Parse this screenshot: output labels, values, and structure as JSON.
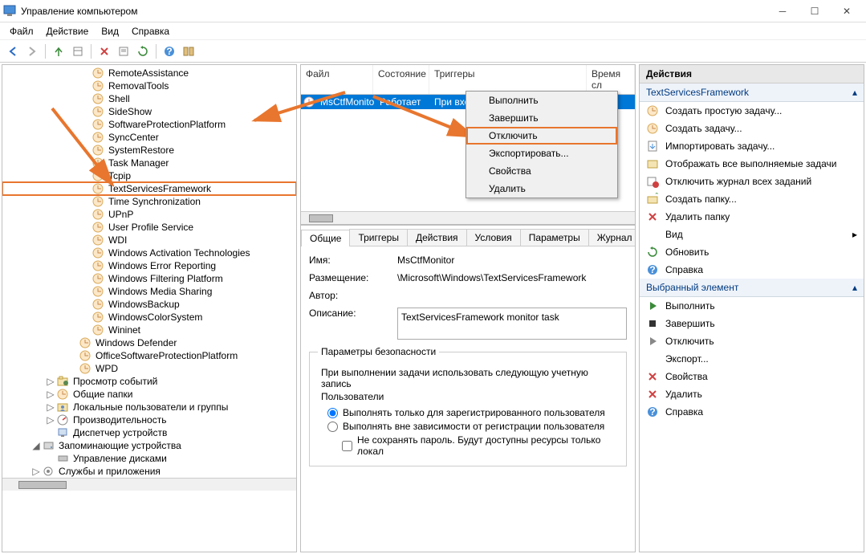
{
  "title": "Управление компьютером",
  "menubar": [
    "Файл",
    "Действие",
    "Вид",
    "Справка"
  ],
  "tree": [
    {
      "label": "RemoteAssistance",
      "lvl": 5
    },
    {
      "label": "RemovalTools",
      "lvl": 5
    },
    {
      "label": "Shell",
      "lvl": 5
    },
    {
      "label": "SideShow",
      "lvl": 5
    },
    {
      "label": "SoftwareProtectionPlatform",
      "lvl": 5
    },
    {
      "label": "SyncCenter",
      "lvl": 5
    },
    {
      "label": "SystemRestore",
      "lvl": 5
    },
    {
      "label": "Task Manager",
      "lvl": 5
    },
    {
      "label": "Tcpip",
      "lvl": 5
    },
    {
      "label": "TextServicesFramework",
      "lvl": 5,
      "selected": true
    },
    {
      "label": "Time Synchronization",
      "lvl": 5
    },
    {
      "label": "UPnP",
      "lvl": 5
    },
    {
      "label": "User Profile Service",
      "lvl": 5
    },
    {
      "label": "WDI",
      "lvl": 5
    },
    {
      "label": "Windows Activation Technologies",
      "lvl": 5
    },
    {
      "label": "Windows Error Reporting",
      "lvl": 5
    },
    {
      "label": "Windows Filtering Platform",
      "lvl": 5
    },
    {
      "label": "Windows Media Sharing",
      "lvl": 5
    },
    {
      "label": "WindowsBackup",
      "lvl": 5
    },
    {
      "label": "WindowsColorSystem",
      "lvl": 5
    },
    {
      "label": "Wininet",
      "lvl": 5
    },
    {
      "label": "Windows Defender",
      "lvl": 4
    },
    {
      "label": "OfficeSoftwareProtectionPlatform",
      "lvl": 4
    },
    {
      "label": "WPD",
      "lvl": 4
    },
    {
      "label": "Просмотр событий",
      "lvl": 2,
      "icon": "event",
      "expand": "▷"
    },
    {
      "label": "Общие папки",
      "lvl": 2,
      "icon": "folder",
      "expand": "▷"
    },
    {
      "label": "Локальные пользователи и группы",
      "lvl": 2,
      "icon": "users",
      "expand": "▷"
    },
    {
      "label": "Производительность",
      "lvl": 2,
      "icon": "perf",
      "expand": "▷"
    },
    {
      "label": "Диспетчер устройств",
      "lvl": 2,
      "icon": "device"
    },
    {
      "label": "Запоминающие устройства",
      "lvl": 1,
      "icon": "storage",
      "expand": "◢"
    },
    {
      "label": "Управление дисками",
      "lvl": 2,
      "icon": "disk"
    },
    {
      "label": "Службы и приложения",
      "lvl": 1,
      "icon": "services",
      "expand": "▷"
    }
  ],
  "task_list": {
    "columns": {
      "file": "Файл",
      "state": "Состояние",
      "triggers": "Триггеры",
      "time": "Время сл"
    },
    "row": {
      "name": "MsCtfMonitor",
      "state": "Работает",
      "trigger": "При входе любого пользователя"
    }
  },
  "context_menu": [
    "Выполнить",
    "Завершить",
    "Отключить",
    "Экспортировать...",
    "Свойства",
    "Удалить"
  ],
  "tabs": [
    "Общие",
    "Триггеры",
    "Действия",
    "Условия",
    "Параметры",
    "Журнал"
  ],
  "general": {
    "name_lbl": "Имя:",
    "name_val": "MsCtfMonitor",
    "loc_lbl": "Размещение:",
    "loc_val": "\\Microsoft\\Windows\\TextServicesFramework",
    "author_lbl": "Автор:",
    "author_val": "",
    "desc_lbl": "Описание:",
    "desc_val": "TextServicesFramework monitor task"
  },
  "security": {
    "group_title": "Параметры безопасности",
    "line1": "При выполнении задачи использовать следующую учетную запись",
    "account": "Пользователи",
    "radio1": "Выполнять только для зарегистрированного пользователя",
    "radio2": "Выполнять вне зависимости от регистрации пользователя",
    "check1": "Не сохранять пароль. Будут доступны ресурсы только локал"
  },
  "actions_panel": {
    "title": "Действия",
    "group1_title": "TextServicesFramework",
    "group1": [
      {
        "icon": "task-new",
        "label": "Создать простую задачу..."
      },
      {
        "icon": "task-new2",
        "label": "Создать задачу..."
      },
      {
        "icon": "import",
        "label": "Импортировать задачу..."
      },
      {
        "icon": "running",
        "label": "Отображать все выполняемые задачи"
      },
      {
        "icon": "log-off",
        "label": "Отключить журнал всех заданий"
      },
      {
        "icon": "folder-new",
        "label": "Создать папку..."
      },
      {
        "icon": "delete-folder",
        "label": "Удалить папку"
      },
      {
        "icon": "view",
        "label": "Вид",
        "arrow": true
      },
      {
        "icon": "refresh",
        "label": "Обновить"
      },
      {
        "icon": "help",
        "label": "Справка"
      }
    ],
    "group2_title": "Выбранный элемент",
    "group2": [
      {
        "icon": "run",
        "label": "Выполнить"
      },
      {
        "icon": "end",
        "label": "Завершить"
      },
      {
        "icon": "disable",
        "label": "Отключить"
      },
      {
        "icon": "export",
        "label": "Экспорт..."
      },
      {
        "icon": "props",
        "label": "Свойства"
      },
      {
        "icon": "delete",
        "label": "Удалить"
      },
      {
        "icon": "help",
        "label": "Справка"
      }
    ]
  }
}
